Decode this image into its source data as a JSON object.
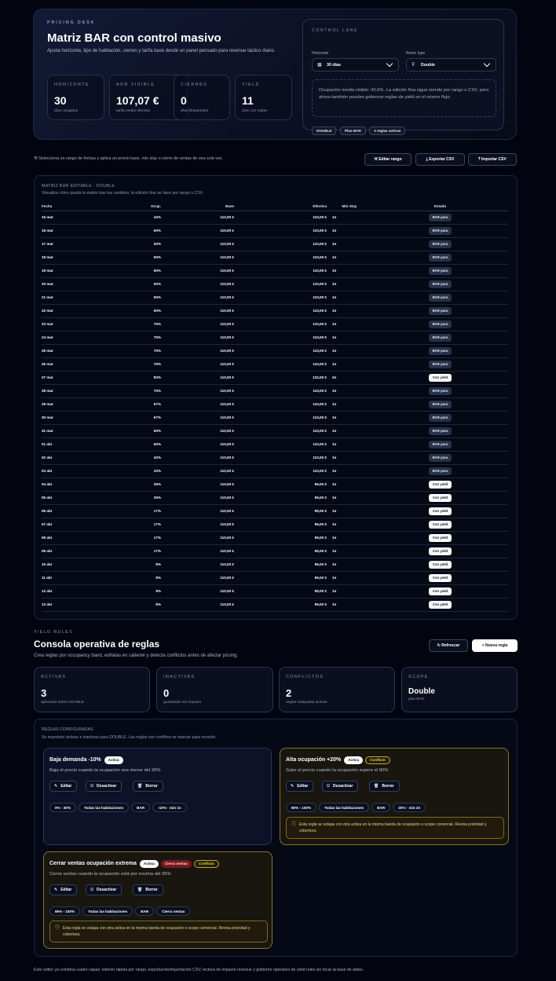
{
  "hero": {
    "eyebrow": "PRICING DESK",
    "title": "Matriz BAR con control masivo",
    "description": "Ajusta horizonte, tipo de habitación, cierres y tarifa base desde un panel pensado para revenue táctico diario.",
    "stats": [
      {
        "label": "HORIZONTE",
        "value": "30",
        "sub": "días cargados"
      },
      {
        "label": "ADR VISIBLE",
        "value": "107,07 €",
        "sub": "tarifa media efectiva"
      },
      {
        "label": "CIERRES",
        "value": "0",
        "sub": "días bloqueados"
      },
      {
        "label": "YIELD",
        "value": "11",
        "sub": "días con reglas"
      }
    ]
  },
  "control": {
    "title": "CONTROL LANE",
    "horizon_label": "Horizonte",
    "horizon_value": "30 días",
    "room_label": "Room type",
    "room_value": "Double",
    "note": "Ocupación media visible: 43.6%. La edición fina sigue siendo por rango o CSV, pero ahora también puedes gobernar reglas de yield en el mismo flujo.",
    "pills": [
      "DOUBLE",
      "Plan BAR",
      "3 reglas activas"
    ]
  },
  "toolbar": {
    "hint": "Selecciona un rango de fechas y aplica un precio base, min stay o cierre de ventas de una sola vez.",
    "edit": "Editar rango",
    "export": "Exportar CSV",
    "import": "Importar CSV"
  },
  "matrix": {
    "title": "MATRIZ BAR EDITABLE · DOUBLE",
    "subtitle": "Visualiza cómo queda la matriz tras tus cambios; la edición fina se hace por rango o CSV.",
    "columns": [
      "Fecha",
      "Ocup.",
      "Base",
      "Efectiva",
      "Min Stay",
      "Estado"
    ],
    "rows": [
      [
        "15 mar",
        "42%",
        "110,00 €",
        "110,00 €",
        "1n",
        "BAR pura"
      ],
      [
        "16 mar",
        "50%",
        "110,00 €",
        "110,00 €",
        "1n",
        "BAR pura"
      ],
      [
        "17 mar",
        "50%",
        "110,00 €",
        "110,00 €",
        "1n",
        "BAR pura"
      ],
      [
        "18 mar",
        "50%",
        "110,00 €",
        "110,00 €",
        "1n",
        "BAR pura"
      ],
      [
        "19 mar",
        "50%",
        "110,00 €",
        "110,00 €",
        "1n",
        "BAR pura"
      ],
      [
        "20 mar",
        "50%",
        "110,00 €",
        "110,00 €",
        "1n",
        "BAR pura"
      ],
      [
        "21 mar",
        "50%",
        "110,00 €",
        "110,00 €",
        "1n",
        "BAR pura"
      ],
      [
        "22 mar",
        "50%",
        "110,00 €",
        "110,00 €",
        "1n",
        "BAR pura"
      ],
      [
        "23 mar",
        "75%",
        "110,00 €",
        "110,00 €",
        "1n",
        "BAR pura"
      ],
      [
        "24 mar",
        "75%",
        "110,00 €",
        "110,00 €",
        "1n",
        "BAR pura"
      ],
      [
        "25 mar",
        "75%",
        "110,00 €",
        "110,00 €",
        "1n",
        "BAR pura"
      ],
      [
        "26 mar",
        "75%",
        "110,00 €",
        "110,00 €",
        "1n",
        "BAR pura"
      ],
      [
        "27 mar",
        "83%",
        "110,00 €",
        "132,00 €",
        "2n",
        "Con yield"
      ],
      [
        "28 mar",
        "75%",
        "110,00 €",
        "110,00 €",
        "1n",
        "BAR pura"
      ],
      [
        "29 mar",
        "67%",
        "110,00 €",
        "110,00 €",
        "1n",
        "BAR pura"
      ],
      [
        "30 mar",
        "67%",
        "110,00 €",
        "110,00 €",
        "1n",
        "BAR pura"
      ],
      [
        "31 mar",
        "50%",
        "110,00 €",
        "110,00 €",
        "1n",
        "BAR pura"
      ],
      [
        "01 abr",
        "50%",
        "110,00 €",
        "110,00 €",
        "1n",
        "BAR pura"
      ],
      [
        "02 abr",
        "42%",
        "110,00 €",
        "110,00 €",
        "1n",
        "BAR pura"
      ],
      [
        "03 abr",
        "33%",
        "110,00 €",
        "110,00 €",
        "1n",
        "BAR pura"
      ],
      [
        "04 abr",
        "25%",
        "110,00 €",
        "99,00 €",
        "1n",
        "Con yield"
      ],
      [
        "05 abr",
        "25%",
        "110,00 €",
        "99,00 €",
        "1n",
        "Con yield"
      ],
      [
        "06 abr",
        "17%",
        "110,00 €",
        "99,00 €",
        "1n",
        "Con yield"
      ],
      [
        "07 abr",
        "17%",
        "110,00 €",
        "99,00 €",
        "1n",
        "Con yield"
      ],
      [
        "08 abr",
        "17%",
        "110,00 €",
        "99,00 €",
        "1n",
        "Con yield"
      ],
      [
        "09 abr",
        "17%",
        "110,00 €",
        "99,00 €",
        "1n",
        "Con yield"
      ],
      [
        "10 abr",
        "8%",
        "110,00 €",
        "99,00 €",
        "1n",
        "Con yield"
      ],
      [
        "11 abr",
        "8%",
        "110,00 €",
        "99,00 €",
        "1n",
        "Con yield"
      ],
      [
        "12 abr",
        "8%",
        "110,00 €",
        "99,00 €",
        "1n",
        "Con yield"
      ],
      [
        "13 abr",
        "8%",
        "110,00 €",
        "99,00 €",
        "1n",
        "Con yield"
      ]
    ]
  },
  "rules": {
    "eyebrow": "YIELD RULES",
    "title": "Consola operativa de reglas",
    "subtitle": "Crea reglas por occupancy band, edítalas en caliente y detecta conflictos antes de afectar pricing.",
    "refresh": "Refrescar",
    "new": "Nueva regla",
    "cards": [
      {
        "label": "ACTIVAS",
        "value": "3",
        "sub": "aplicando sobre DOUBLE"
      },
      {
        "label": "INACTIVAS",
        "value": "0",
        "sub": "guardadas sin impacto"
      },
      {
        "label": "CONFLICTOS",
        "value": "2",
        "sub": "reglas solapadas activas"
      },
      {
        "label": "SCOPE",
        "value": "Double",
        "sub": "plan BAR"
      }
    ],
    "configured_title": "REGLAS CONFIGURADAS",
    "configured_sub": "Se muestran activas e inactivas para DOUBLE. Las reglas con conflicto se marcan para revisión.",
    "edit": "Editar",
    "deactivate": "Desactivar",
    "delete": "Borrar",
    "items": [
      {
        "title": "Baja demanda -10%",
        "status": "Activa",
        "desc": "Baja el precio cuando la ocupación sea menor del 30%",
        "chips": [
          "0% - 30%",
          "Todas las habitaciones",
          "BAR",
          "-10% · min 1n"
        ]
      },
      {
        "title": "Alta ocupación +20%",
        "status": "Activa",
        "conflict": "Conflicto",
        "desc": "Sube el precio cuando la ocupación supere el 80%",
        "chips": [
          "80% - 100%",
          "Todas las habitaciones",
          "BAR",
          "20% · min 2n"
        ],
        "warning": "Esta regla se solapa con otra activa en la misma banda de ocupación o scope comercial. Revisa prioridad y cobertura."
      },
      {
        "title": "Cerrar ventas ocupación extrema",
        "status": "Activa",
        "closes": "Cierra ventas",
        "conflict": "Conflicto",
        "desc": "Cierra ventas cuando la ocupación está por encima del 95%",
        "chips": [
          "95% - 100%",
          "Todas las habitaciones",
          "BAR",
          "Cierra ventas"
        ],
        "warning": "Esta regla se solapa con otra activa en la misma banda de ocupación o scope comercial. Revisa prioridad y cobertura."
      }
    ]
  },
  "footer": "Este editor ya combina cuatro capas: edición rápida por rango, exportación/importación CSV, lectura de impacto revenue y gobierno operativo de yield rules sin tocar la base de datos.",
  "icons": [
    "calendar-icon",
    "filter-icon",
    "chevron-down-icon",
    "wand-icon",
    "download-icon",
    "upload-icon",
    "refresh-icon",
    "plus-icon",
    "pencil-icon",
    "power-icon",
    "trash-icon",
    "alert-icon"
  ]
}
